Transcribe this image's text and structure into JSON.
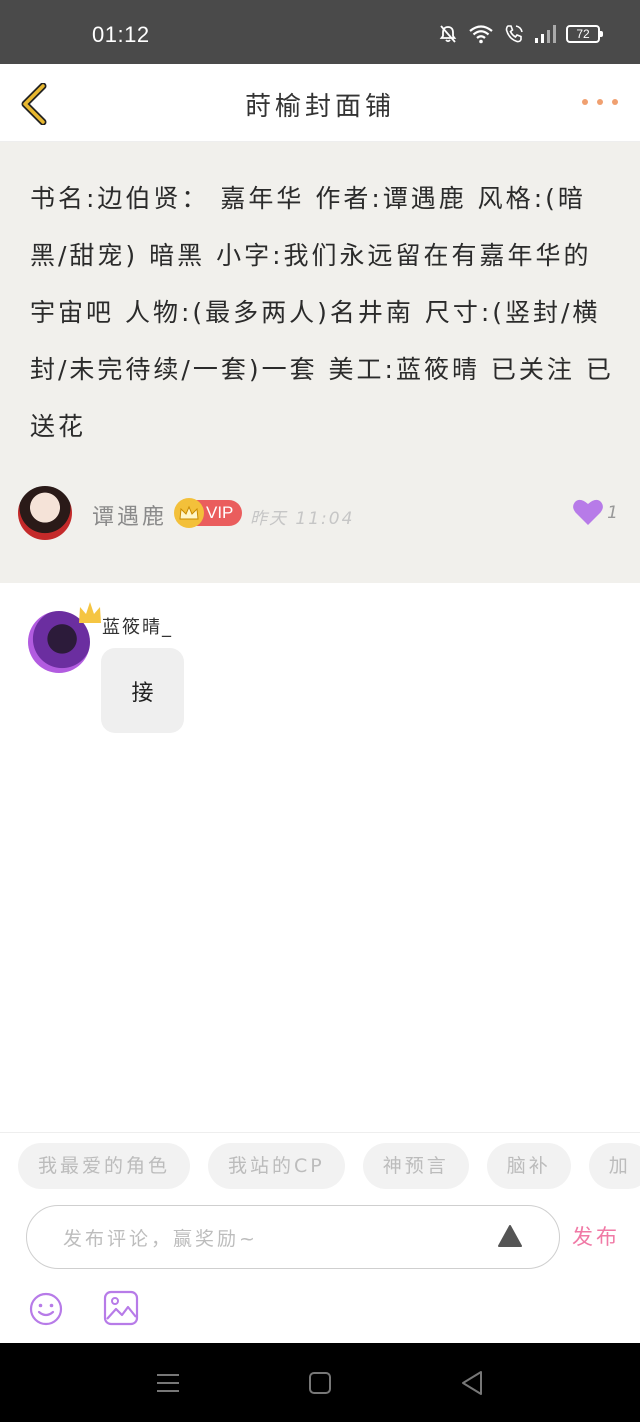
{
  "status_bar": {
    "time": "01:12",
    "battery": "72",
    "icons": [
      "mute-bell-icon",
      "wifi-icon",
      "call-icon",
      "signal-icon",
      "battery-icon"
    ]
  },
  "header": {
    "title": "莳榆封面铺",
    "back_icon": "chevron-left-icon",
    "more_icon": "more-dots-icon"
  },
  "post": {
    "text": "书名:边伯贤： 嘉年华  作者:谭遇鹿  风格:(暗黑/甜宠) 暗黑  小字:我们永远留在有嘉年华的宇宙吧 人物:(最多两人)名井南 尺寸:(竖封/横封/未完待续/一套)一套  美工:蓝筱晴  已关注 已送花",
    "author": {
      "name": "谭遇鹿",
      "badge": "VIP",
      "time": "昨天 11:04"
    },
    "likes": "1"
  },
  "comment": {
    "user": "蓝筱晴_",
    "text": "接"
  },
  "bottom": {
    "tags": [
      "我最爱的角色",
      "我站的CP",
      "神预言",
      "脑补",
      "加"
    ],
    "input_placeholder": "发布评论，赢奖励~",
    "publish_label": "发布",
    "icons": [
      "emoji-icon",
      "image-icon"
    ]
  },
  "colors": {
    "accent": "#f07aa6",
    "back_arrow": "#e8b830",
    "like": "#b77be8",
    "vip": "#ea5d5d",
    "post_bg": "#f1f0ec"
  }
}
